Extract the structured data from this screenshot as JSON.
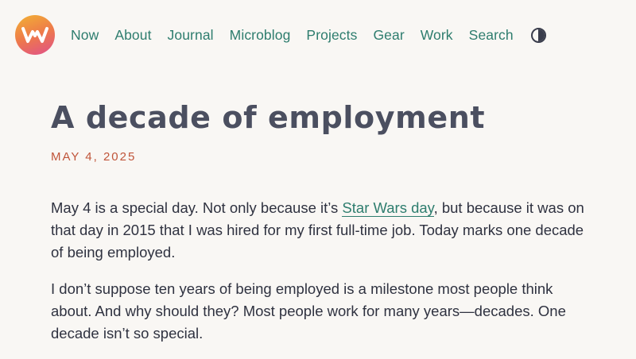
{
  "nav": {
    "items": [
      "Now",
      "About",
      "Journal",
      "Microblog",
      "Projects",
      "Gear",
      "Work",
      "Search"
    ],
    "theme_toggle_icon": "contrast-icon"
  },
  "article": {
    "title": "A decade of employment",
    "date": "MAY 4, 2025",
    "p1_before": "May 4 is a special day. Not only because it’s ",
    "p1_link": "Star Wars day",
    "p1_after": ", but because it was on that day in 2015 that I was hired for my first full-time job. Today marks one decade of being employed.",
    "p2": "I don’t suppose ten years of being employed is a milestone most people think about. And why should they? Most people work for many years—decades. One decade isn’t so special."
  },
  "colors": {
    "background": "#f9f7f4",
    "link": "#2e7d6e",
    "date": "#c0553a",
    "title": "#4b4f60"
  }
}
